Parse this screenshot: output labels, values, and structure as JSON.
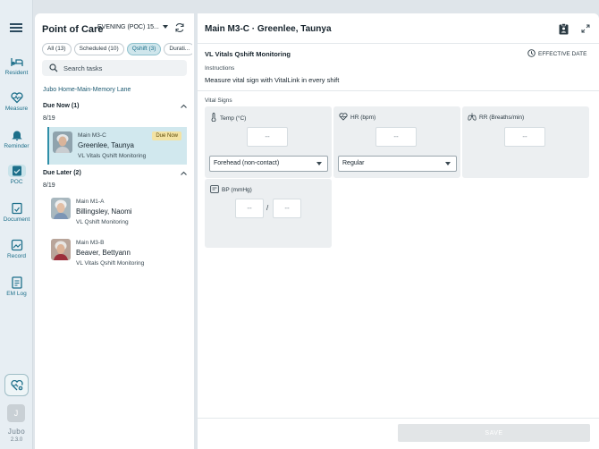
{
  "nav": {
    "items": [
      {
        "label": "Resident",
        "icon": "bed-icon",
        "active": false
      },
      {
        "label": "Measure",
        "icon": "heart-pulse-icon",
        "active": false
      },
      {
        "label": "Reminder",
        "icon": "bell-icon",
        "active": false
      },
      {
        "label": "POC",
        "icon": "poc-icon",
        "active": true
      },
      {
        "label": "Document",
        "icon": "document-icon",
        "active": false
      },
      {
        "label": "Record",
        "icon": "record-icon",
        "active": false
      },
      {
        "label": "EM Log",
        "icon": "log-icon",
        "active": false
      }
    ],
    "user_initial": "J",
    "brand": "Jubo",
    "version": "2.3.0"
  },
  "left": {
    "title": "Point of Care",
    "shift": "EVENING (POC) 15...",
    "chips": [
      "All (13)",
      "Scheduled (10)",
      "Qshift (3)",
      "Durati..."
    ],
    "active_chip": 2,
    "search_placeholder": "Search tasks",
    "facility": "Jubo Home-Main-Memory Lane",
    "due_now": {
      "header": "Due Now (1)",
      "date": "8/19",
      "items": [
        {
          "room": "Main M3-C",
          "name": "Greenlee, Taunya",
          "task": "VL Vitals Qshift Monitoring",
          "badge": "Due Now"
        }
      ]
    },
    "due_later": {
      "header": "Due Later (2)",
      "date": "8/19",
      "items": [
        {
          "room": "Main M1-A",
          "name": "Billingsley, Naomi",
          "task": "VL Qshift Monitoring"
        },
        {
          "room": "Main M3-B",
          "name": "Beaver, Bettyann",
          "task": "VL Vitals Qshift Monitoring"
        }
      ]
    }
  },
  "detail": {
    "title": "Main M3-C · Greenlee, Taunya",
    "task_title": "VL Vitals Qshift Monitoring",
    "effective_date_label": "EFFECTIVE DATE",
    "instructions_label": "Instructions",
    "instructions": "Measure vital sign with VitalLink in every shift",
    "vital_signs_label": "Vital Signs",
    "temp": {
      "label": "Temp (°C)",
      "value": "--",
      "method": "Forehead (non-contact)"
    },
    "hr": {
      "label": "HR (bpm)",
      "value": "--",
      "rhythm": "Regular"
    },
    "rr": {
      "label": "RR (Breaths/min)",
      "value": "--"
    },
    "bp": {
      "label": "BP (mmHg)",
      "systolic": "--",
      "diastolic": "--",
      "separator": "/"
    },
    "save_label": "SAVE"
  },
  "colors": {
    "accent": "#1d6f8a",
    "selected_bg": "#d1e8ee",
    "badge_bg": "#f3e3a4"
  }
}
